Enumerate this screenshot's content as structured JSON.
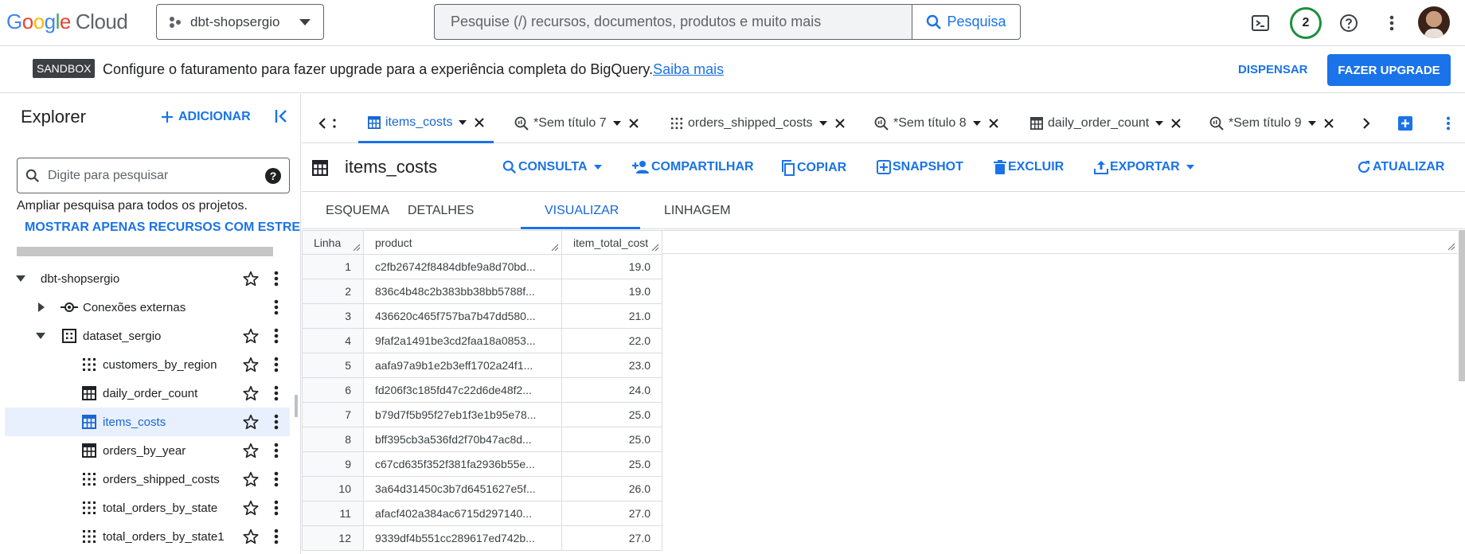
{
  "header": {
    "logo_google": [
      "G",
      "o",
      "o",
      "g",
      "l",
      "e"
    ],
    "logo_cloud": "Cloud",
    "project_name": "dbt-shopsergio",
    "search_placeholder": "Pesquise (/) recursos, documentos, produtos e muito mais",
    "search_button": "Pesquisa",
    "notification_count": "2"
  },
  "banner": {
    "tag": "SANDBOX",
    "text": "Configure o faturamento para fazer upgrade para a experiência completa do BigQuery.",
    "link": "Saiba mais",
    "dismiss": "DISPENSAR",
    "upgrade": "FAZER UPGRADE"
  },
  "explorer": {
    "title": "Explorer",
    "add": "ADICIONAR",
    "search_placeholder": "Digite para pesquisar",
    "help": "?",
    "ampliar": "Ampliar pesquisa para todos os projetos.",
    "mostrar": "MOSTRAR APENAS RECURSOS COM ESTRELA",
    "tree": [
      {
        "label": "dbt-shopsergio"
      },
      {
        "label": "Conexões externas"
      },
      {
        "label": "dataset_sergio"
      },
      {
        "label": "customers_by_region"
      },
      {
        "label": "daily_order_count"
      },
      {
        "label": "items_costs"
      },
      {
        "label": "orders_by_year"
      },
      {
        "label": "orders_shipped_costs"
      },
      {
        "label": "total_orders_by_state"
      },
      {
        "label": "total_orders_by_state1"
      }
    ]
  },
  "tabs": [
    {
      "label": "items_costs",
      "icon": "table-icon"
    },
    {
      "label": "*Sem título 7",
      "icon": "query-icon"
    },
    {
      "label": "orders_shipped_costs",
      "icon": "view-icon"
    },
    {
      "label": "*Sem título 8",
      "icon": "query-icon"
    },
    {
      "label": "daily_order_count",
      "icon": "table-icon"
    },
    {
      "label": "*Sem título 9",
      "icon": "query-icon"
    }
  ],
  "toolbar": {
    "title": "items_costs",
    "consulta": "CONSULTA",
    "compartilhar": "COMPARTILHAR",
    "copiar": "COPIAR",
    "snapshot": "SNAPSHOT",
    "excluir": "EXCLUIR",
    "exportar": "EXPORTAR",
    "atualizar": "ATUALIZAR"
  },
  "subtabs": [
    "ESQUEMA",
    "DETALHES",
    "VISUALIZAR",
    "LINHAGEM"
  ],
  "table": {
    "headers": [
      "Linha",
      "product",
      "item_total_cost"
    ],
    "rows": [
      [
        "1",
        "c2fb26742f8484dbfe9a8d70bd...",
        "19.0"
      ],
      [
        "2",
        "836c4b48c2b383bb38bb5788f...",
        "19.0"
      ],
      [
        "3",
        "436620c465f757ba7b47dd580...",
        "21.0"
      ],
      [
        "4",
        "9faf2a1491be3cd2faa18a0853...",
        "22.0"
      ],
      [
        "5",
        "aafa97a9b1e2b3eff1702a24f1...",
        "23.0"
      ],
      [
        "6",
        "fd206f3c185fd47c22d6de48f2...",
        "24.0"
      ],
      [
        "7",
        "b79d7f5b95f27eb1f3e1b95e78...",
        "25.0"
      ],
      [
        "8",
        "bff395cb3a536fd2f70b47ac8d...",
        "25.0"
      ],
      [
        "9",
        "c67cd635f352f381fa2936b55e...",
        "25.0"
      ],
      [
        "10",
        "3a64d31450c3b7d6451627e5f...",
        "26.0"
      ],
      [
        "11",
        "afacf402a384ac6715d297140...",
        "27.0"
      ],
      [
        "12",
        "9339df4b551cc289617ed742b...",
        "27.0"
      ]
    ]
  }
}
